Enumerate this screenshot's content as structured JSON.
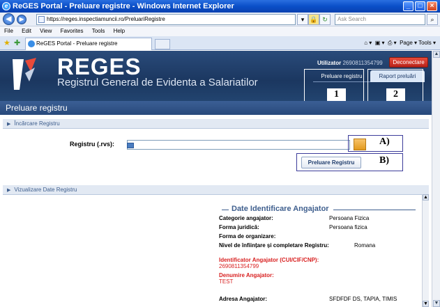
{
  "browser": {
    "window_title": "ReGES Portal - Preluare registre - Windows Internet Explorer",
    "url": "https://reges.inspectiamuncii.ro/PreluariRegistre",
    "search_placeholder": "Ask Search",
    "menu": [
      "File",
      "Edit",
      "View",
      "Favorites",
      "Tools",
      "Help"
    ],
    "tab_title": "ReGES Portal - Preluare registre",
    "toolbar_right": "Page ▾  Tools ▾"
  },
  "header": {
    "logo_title": "REGES",
    "logo_subtitle": "Registrul General de Evidenta a Salariatilor",
    "user_label": "Utilizator",
    "user_id": "2690811354799",
    "logout_label": "Deconectare",
    "nav": [
      {
        "label": "Preluare registru",
        "annotation": "1"
      },
      {
        "label": "Raport preluări",
        "annotation": "2"
      }
    ]
  },
  "main": {
    "section_title": "Preluare registru",
    "upload_panel": {
      "heading": "Încărcare Registru",
      "field_label": "Registru (.rvs):",
      "browse_annotation": "A)",
      "submit_label": "Preluare Registru",
      "submit_annotation": "B)"
    },
    "view_panel": {
      "heading": "Vizualizare Date Registru",
      "legend": "Date Identificare Angajator",
      "fields": [
        {
          "label": "Categorie angajator:",
          "value": "Persoana Fizica"
        },
        {
          "label": "Forma juridică:",
          "value": "Persoana fizica"
        },
        {
          "label": "Forma de organizare:",
          "value": ""
        },
        {
          "label": "Nivel de înființare și completare Registru:",
          "value": "Romana"
        }
      ],
      "id_label": "Identificator Angajator (CUI/CIF/CNP):",
      "id_value": "2690811354799",
      "name_label": "Denumire Angajator:",
      "name_value": "TEST",
      "address_label": "Adresa Angajator:",
      "address_value": "SFDFDF DS, TAPIA, TIMIS"
    }
  },
  "colors": {
    "title_bar": "#0a4fc8",
    "header_bg": "#1b3760",
    "section_bar": "#2f5286",
    "logout_red": "#d03328",
    "required_red": "#d81f1f"
  }
}
